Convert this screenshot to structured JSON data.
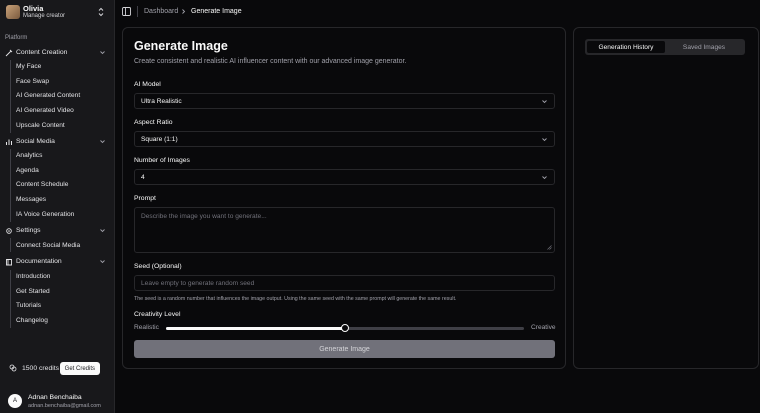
{
  "user": {
    "name": "Olivia",
    "role": "Manage creator"
  },
  "sidebar": {
    "group_label": "Platform",
    "sections": [
      {
        "label": "Content Creation",
        "icon": "wand-icon",
        "items": [
          "My Face",
          "Face Swap",
          "AI Generated Content",
          "AI Generated Video",
          "Upscale Content"
        ]
      },
      {
        "label": "Social Media",
        "icon": "bar-chart-icon",
        "items": [
          "Analytics",
          "Agenda",
          "Content Schedule",
          "Messages",
          "IA Voice Generation"
        ]
      },
      {
        "label": "Settings",
        "icon": "gear-icon",
        "items": [
          "Connect Social Media"
        ]
      },
      {
        "label": "Documentation",
        "icon": "book-icon",
        "items": [
          "Introduction",
          "Get Started",
          "Tutorials",
          "Changelog"
        ]
      }
    ],
    "credits_text": "1500 credits",
    "get_credits_label": "Get Credits",
    "footer_user": {
      "initial": "A",
      "name": "Adnan Benchaiba",
      "email": "adnan.benchaiba@gmail.com"
    }
  },
  "breadcrumb": {
    "parent": "Dashboard",
    "current": "Generate Image"
  },
  "form": {
    "title": "Generate Image",
    "description": "Create consistent and realistic AI influencer content with our advanced image generator.",
    "model_label": "AI Model",
    "model_value": "Ultra Realistic",
    "aspect_label": "Aspect Ratio",
    "aspect_value": "Square (1:1)",
    "count_label": "Number of Images",
    "count_value": "4",
    "prompt_label": "Prompt",
    "prompt_placeholder": "Describe the image you want to generate...",
    "seed_label": "Seed (Optional)",
    "seed_placeholder": "Leave empty to generate random seed",
    "seed_hint": "The seed is a random number that influences the image output. Using the same seed with the same prompt will generate the same result.",
    "creativity_label": "Creativity Level",
    "creativity_min": "Realistic",
    "creativity_max": "Creative",
    "creativity_value": 0.5,
    "generate_label": "Generate Image"
  },
  "history": {
    "tabs": [
      "Generation History",
      "Saved Images"
    ],
    "active_tab": 0
  }
}
